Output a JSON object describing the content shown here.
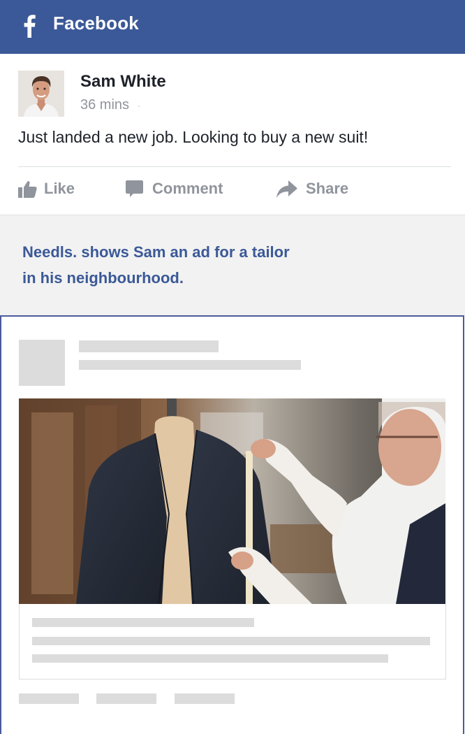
{
  "app": {
    "title": "Facebook",
    "brand_color": "#3b5998"
  },
  "post": {
    "author": "Sam White",
    "time": "36 mins",
    "time_separator": "·",
    "text": "Just landed a new job. Looking to buy a new suit!",
    "actions": [
      {
        "label": "Like",
        "icon": "thumbs-up-icon"
      },
      {
        "label": "Comment",
        "icon": "comment-icon"
      },
      {
        "label": "Share",
        "icon": "share-arrow-icon"
      }
    ]
  },
  "note": {
    "line1": "Needls. shows Sam an ad for a tailor",
    "line2": "in his neighbourhood."
  },
  "ad": {
    "image_subject": "tailor measuring a suit jacket on a mannequin",
    "placeholder_color": "#dcdcdc",
    "border_color": "#4b5b9a"
  }
}
